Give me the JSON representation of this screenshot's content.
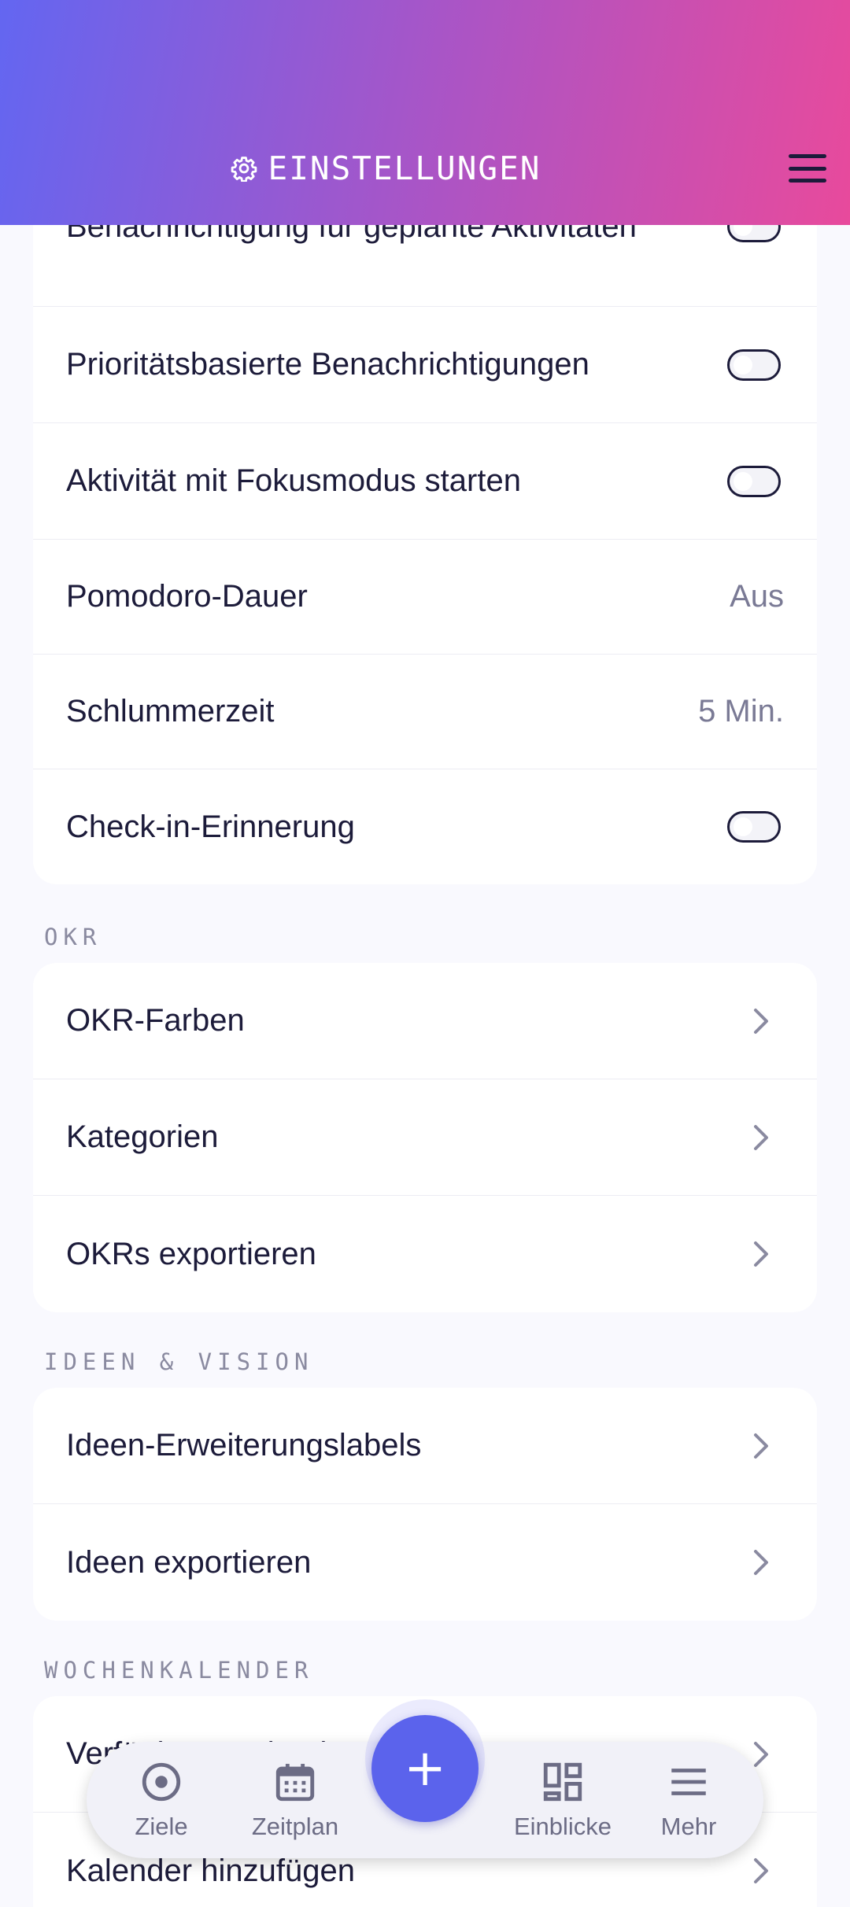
{
  "header": {
    "title": "EINSTELLUNGEN"
  },
  "notifications": {
    "rows": [
      {
        "label": "Benachrichtigung für geplante Aktivitäten",
        "toggle_on": false
      },
      {
        "label": "Prioritätsbasierte Benachrichtigungen",
        "toggle_on": false
      },
      {
        "label": "Aktivität mit Fokusmodus starten",
        "toggle_on": false
      },
      {
        "label": "Pomodoro-Dauer",
        "value": "Aus"
      },
      {
        "label": "Schlummerzeit",
        "value": "5 Min."
      },
      {
        "label": "Check-in-Erinnerung",
        "toggle_on": false
      }
    ]
  },
  "okr": {
    "heading": "OKR",
    "rows": [
      {
        "label": "OKR-Farben"
      },
      {
        "label": "Kategorien"
      },
      {
        "label": "OKRs exportieren"
      }
    ]
  },
  "ideas": {
    "heading": "IDEEN & VISION",
    "rows": [
      {
        "label": "Ideen-Erweiterungslabels"
      },
      {
        "label": "Ideen exportieren"
      }
    ]
  },
  "calendar": {
    "heading": "WOCHENKALENDER",
    "rows": [
      {
        "label": "Verfügbare Kalender"
      },
      {
        "label": "Kalender hinzufügen"
      }
    ]
  },
  "bottom_nav": {
    "items": [
      {
        "label": "Ziele",
        "icon": "target-icon"
      },
      {
        "label": "Zeitplan",
        "icon": "calendar-icon"
      },
      {
        "label": "Einblicke",
        "icon": "dashboard-icon"
      },
      {
        "label": "Mehr",
        "icon": "menu-icon"
      }
    ],
    "fab_symbol": "+"
  },
  "colors": {
    "accent": "#5b63ec",
    "gradient_start": "#6366f1",
    "gradient_end": "#e84a9c",
    "text_primary": "#1c1b3a",
    "text_secondary": "#7a7a95"
  }
}
